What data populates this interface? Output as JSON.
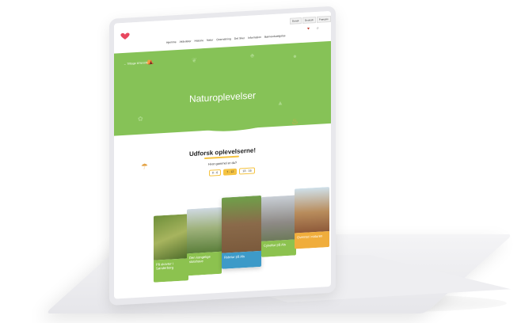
{
  "website": {
    "languages": [
      "Dansk",
      "Deutsch",
      "Français"
    ],
    "nav_items": [
      "Hjemme",
      "Aktiviteter",
      "Historie",
      "Natur",
      "Overnatning",
      "Det Sker",
      "Information",
      "Børneudvælgelse"
    ],
    "back_link": "← Tilbage til forside",
    "hero_title": "Naturoplevelser",
    "section_title": "Udforsk oplevelserne!",
    "age_question": "Hvor gammel er du?",
    "age_options": [
      "0 - 6",
      "7 - 12",
      "13 - 16"
    ],
    "selected_age": "7 - 12",
    "cards": [
      {
        "label": "På skovtur i Sønderborg",
        "color": "#8cc24f"
      },
      {
        "label": "Den kongelige slotshave",
        "color": "#8cc24f"
      },
      {
        "label": "Ridetur på Als",
        "color": "#3d9ac8"
      },
      {
        "label": "Cykeltur på Als",
        "color": "#8cc24f"
      },
      {
        "label": "Overnat i naturen",
        "color": "#f0ad3c"
      }
    ],
    "colors": {
      "hero": "#86c257",
      "accent": "#f5c341"
    }
  }
}
